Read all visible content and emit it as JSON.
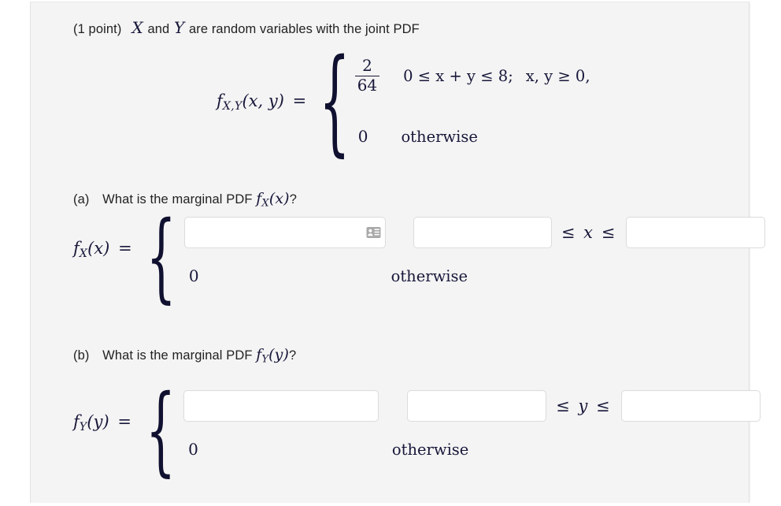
{
  "question": {
    "points_label": "(1 point)",
    "intro_before": "and",
    "intro_after": "are random variables with the joint PDF",
    "var1": "X",
    "var2": "Y"
  },
  "joint_pdf": {
    "lhs_f": "f",
    "lhs_sub": "X,Y",
    "lhs_args": "(x, y)",
    "equals": "=",
    "brace": "{",
    "case1_numerator": "2",
    "case1_denominator": "64",
    "case1_condition_left": "0 ≤ x + y ≤ 8;",
    "case1_condition_right": "x, y ≥ 0,",
    "case2_value": "0",
    "case2_condition": "otherwise"
  },
  "part_a": {
    "tag": "(a)",
    "text": "What is the marginal PDF",
    "func_f": "f",
    "func_sub": "X",
    "func_args": "(x)",
    "question_mark": "?",
    "lhs_f": "f",
    "lhs_sub": "X",
    "lhs_args": "(x)",
    "equals": "=",
    "brace": "{",
    "expr_value": "",
    "expr_placeholder": "",
    "range_low_value": "",
    "range_low_placeholder": "",
    "range_separator_left": "≤",
    "range_separator_var": "x",
    "range_separator_right": "≤",
    "range_high_value": "",
    "range_high_placeholder": "",
    "zero_value": "0",
    "otherwise": "otherwise",
    "icon": "contact-card-icon"
  },
  "part_b": {
    "tag": "(b)",
    "text": "What is the marginal PDF",
    "func_f": "f",
    "func_sub": "Y",
    "func_args": "(y)",
    "question_mark": "?",
    "lhs_f": "f",
    "lhs_sub": "Y",
    "lhs_args": "(y)",
    "equals": "=",
    "brace": "{",
    "expr_value": "",
    "expr_placeholder": "",
    "range_low_value": "",
    "range_low_placeholder": "",
    "range_separator_left": "≤",
    "range_separator_var": "y",
    "range_separator_right": "≤",
    "range_high_value": "",
    "range_high_placeholder": "",
    "zero_value": "0",
    "otherwise": "otherwise"
  },
  "colors": {
    "panel_background": "#f4f4f4",
    "page_background": "#ffffff",
    "text": "#222222",
    "math_text": "#17173a",
    "input_background": "#ffffff",
    "input_border": "#dcdcdc",
    "icon_gray": "#a9a9a9"
  }
}
